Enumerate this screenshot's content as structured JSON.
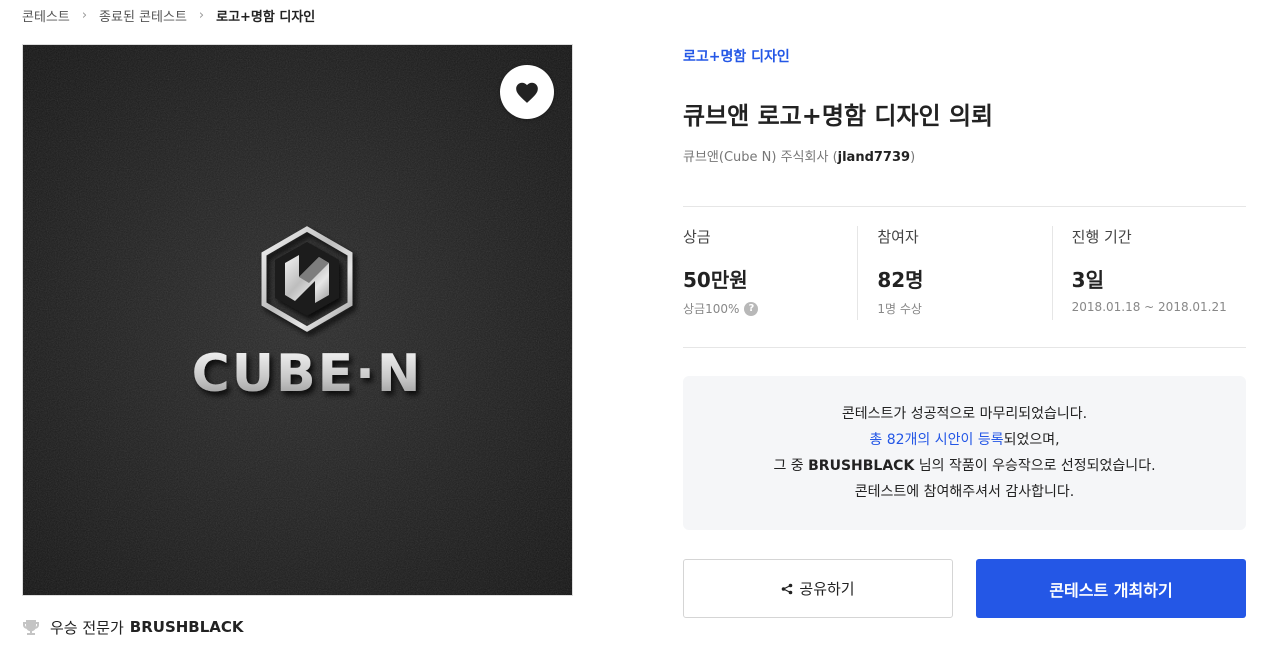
{
  "breadcrumb": [
    {
      "label": "콘테스트"
    },
    {
      "label": "종료된 콘테스트"
    },
    {
      "label": "로고+명함 디자인"
    }
  ],
  "image": {
    "logo_text": "CUBE·N",
    "logo_mark": "N"
  },
  "winner": {
    "icon": "trophy-icon",
    "label": "우승 전문가",
    "name": "BRUSHBLACK"
  },
  "category": "로고+명함 디자인",
  "title": "큐브앤 로고+명함 디자인 의뢰",
  "client": {
    "company": "큐브앤(Cube N) 주식회사",
    "open_paren": "(",
    "id": "jland7739",
    "close_paren": ")"
  },
  "stats": [
    {
      "label": "상금",
      "value": "50만원",
      "sub": "상금100%",
      "has_help": true
    },
    {
      "label": "참여자",
      "value": "82명",
      "sub": "1명 수상"
    },
    {
      "label": "진행 기간",
      "value": "3일",
      "sub": "2018.01.18 ~ 2018.01.21"
    }
  ],
  "notice": {
    "line1": "콘테스트가 성공적으로 마무리되었습니다.",
    "line2_link": "총 82개의 시안이 등록",
    "line2_rest": "되었으며,",
    "line3_pre": "그 중 ",
    "line3_name": "BRUSHBLACK",
    "line3_post": " 님의 작품이 우승작으로 선정되었습니다.",
    "line4": "콘테스트에 참여해주셔서 감사합니다."
  },
  "buttons": {
    "share": "공유하기",
    "host": "콘테스트 개최하기"
  },
  "colors": {
    "accent": "#2457e6",
    "notice_bg": "#f5f6f8"
  }
}
